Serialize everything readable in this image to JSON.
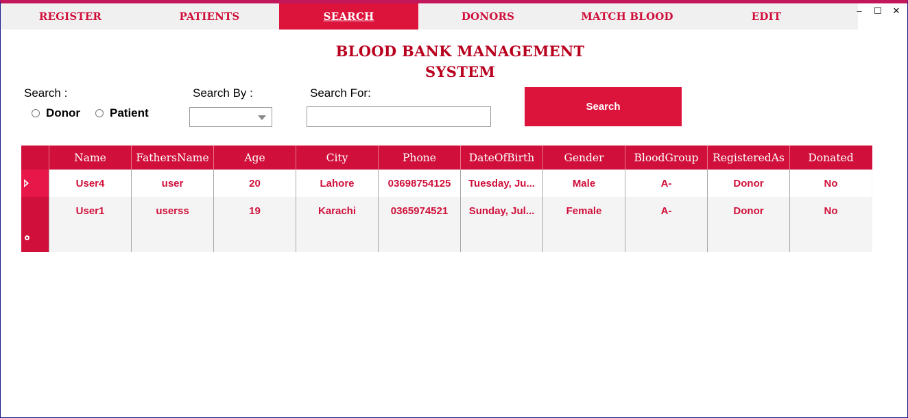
{
  "nav": {
    "items": [
      {
        "label": "REGISTER"
      },
      {
        "label": "PATIENTS"
      },
      {
        "label": "SEARCH"
      },
      {
        "label": "DONORS"
      },
      {
        "label": "MATCH BLOOD"
      },
      {
        "label": "EDIT"
      }
    ],
    "active": "SEARCH"
  },
  "window_controls": {
    "minimize": "–",
    "maximize": "☐",
    "close": "✕"
  },
  "title": {
    "line1": "BLOOD BANK MANAGEMENT",
    "line2": "SYSTEM"
  },
  "form": {
    "search_label": "Search  :",
    "donor_option": "Donor",
    "patient_option": "Patient",
    "search_by_label": "Search  By :",
    "search_by_value": "",
    "search_for_label": "Search  For:",
    "search_for_value": "",
    "search_button": "Search"
  },
  "grid": {
    "columns": [
      "Name",
      "FathersName",
      "Age",
      "City",
      "Phone",
      "DateOfBirth",
      "Gender",
      "BloodGroup",
      "RegisteredAs",
      "Donated"
    ],
    "rows": [
      [
        "User4",
        "user",
        "20",
        "Lahore",
        "03698754125",
        "Tuesday, Ju...",
        "Male",
        "A-",
        "Donor",
        "No"
      ],
      [
        "User1",
        "userss",
        "19",
        "Karachi",
        "0365974521",
        "Sunday, Jul...",
        "Female",
        "A-",
        "Donor",
        "No"
      ]
    ]
  },
  "colors": {
    "accent": "#dc143c",
    "title": "#b8001e",
    "border": "#1a1a8c"
  }
}
